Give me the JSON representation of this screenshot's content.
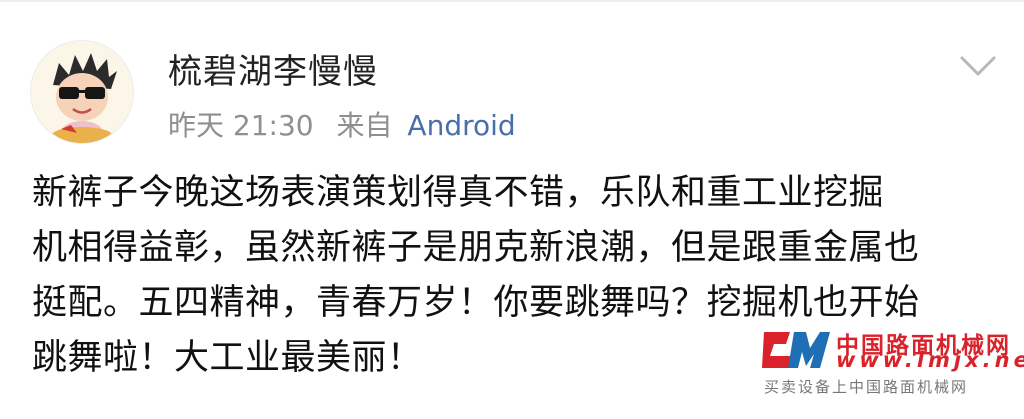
{
  "post": {
    "username": "梳碧湖李慢慢",
    "time": "昨天 21:30",
    "source_label": "来自",
    "source_name": "Android",
    "body_lines": [
      "新裤子今晚这场表演策划得真不错，乐队和重工业挖掘",
      "机相得益彰，虽然新裤子是朋克新浪潮，但是跟重金属也",
      "挺配。五四精神，青春万岁！你要跳舞吗？挖掘机也开始",
      "跳舞啦！大工业最美丽！"
    ],
    "avatar_icon": "cartoon-avatar-with-sunglasses",
    "more_icon": "chevron-down-icon"
  },
  "watermark": {
    "name": "中国路面机械网",
    "url": "www.lmjx.net",
    "slogan": "买卖设备上中国路面机械网"
  },
  "colors": {
    "link": "#4a6ea9",
    "meta": "#8f8f8f",
    "watermark_red": "#d9222a",
    "watermark_blue": "#1f6fb5"
  }
}
